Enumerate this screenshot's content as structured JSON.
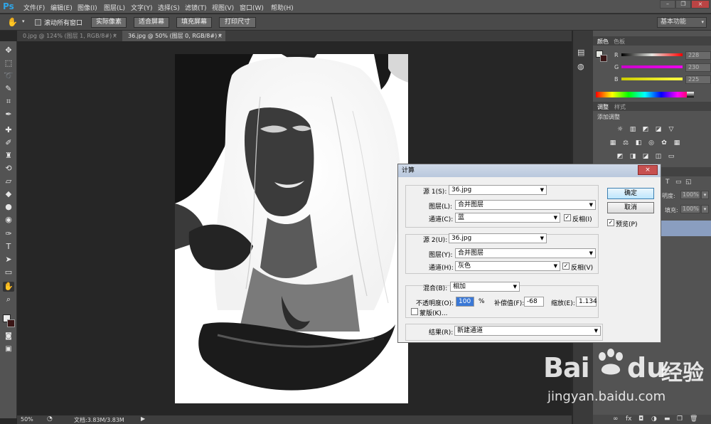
{
  "app": {
    "logo": "Ps"
  },
  "menu": [
    "文件(F)",
    "编辑(E)",
    "图像(I)",
    "图层(L)",
    "文字(Y)",
    "选择(S)",
    "滤镜(T)",
    "视图(V)",
    "窗口(W)",
    "帮助(H)"
  ],
  "options": {
    "scroll_all_label": "滚动所有窗口",
    "buttons": [
      "实际像素",
      "适合屏幕",
      "填充屏幕",
      "打印尺寸"
    ],
    "workspace": "基本功能"
  },
  "doc_tabs": [
    {
      "label": "0.jpg @ 124% (图层 1, RGB/8#) *",
      "close": "×"
    },
    {
      "label": "36.jpg @ 50% (图层 0, RGB/8#) *",
      "close": "×"
    }
  ],
  "status": {
    "zoom": "50%",
    "doc": "文档:3.83M/3.83M"
  },
  "panels": {
    "color_tab": "颜色",
    "swatch_tab": "色板",
    "r_label": "R",
    "g_label": "G",
    "b_label": "B",
    "r_value": "228",
    "g_value": "230",
    "b_value": "225",
    "adjust_tab": "调整",
    "style_tab": "样式",
    "add_adjust": "添加调整",
    "opacity_label": "明度:",
    "opacity_value": "100%",
    "fill_label": "填充:",
    "fill_value": "100%"
  },
  "dialog": {
    "title": "计算",
    "close": "×",
    "ok": "确定",
    "cancel": "取消",
    "preview": "预览(P)",
    "source1": {
      "label": "源 1(S):",
      "file": "36.jpg",
      "layer_label": "图层(L):",
      "layer": "合并图层",
      "channel_label": "通道(C):",
      "channel": "蓝",
      "invert": "反相(I)"
    },
    "source2": {
      "label": "源 2(U):",
      "file": "36.jpg",
      "layer_label": "图层(Y):",
      "layer": "合并图层",
      "channel_label": "通道(H):",
      "channel": "灰色",
      "invert": "反相(V)"
    },
    "blend": {
      "label": "混合(B):",
      "mode": "相加",
      "opacity_label": "不透明度(O):",
      "opacity": "100",
      "pct": "%",
      "offset_label": "补偿值(F):",
      "offset": "-68",
      "scale_label": "缩放(E):",
      "scale": "1.134",
      "mask": "蒙版(K)..."
    },
    "result": {
      "label": "结果(R):",
      "value": "新建通道"
    }
  },
  "watermark": {
    "brand": "Bai",
    "du": "du",
    "cn": "经验",
    "url": "jingyan.baidu.com"
  }
}
